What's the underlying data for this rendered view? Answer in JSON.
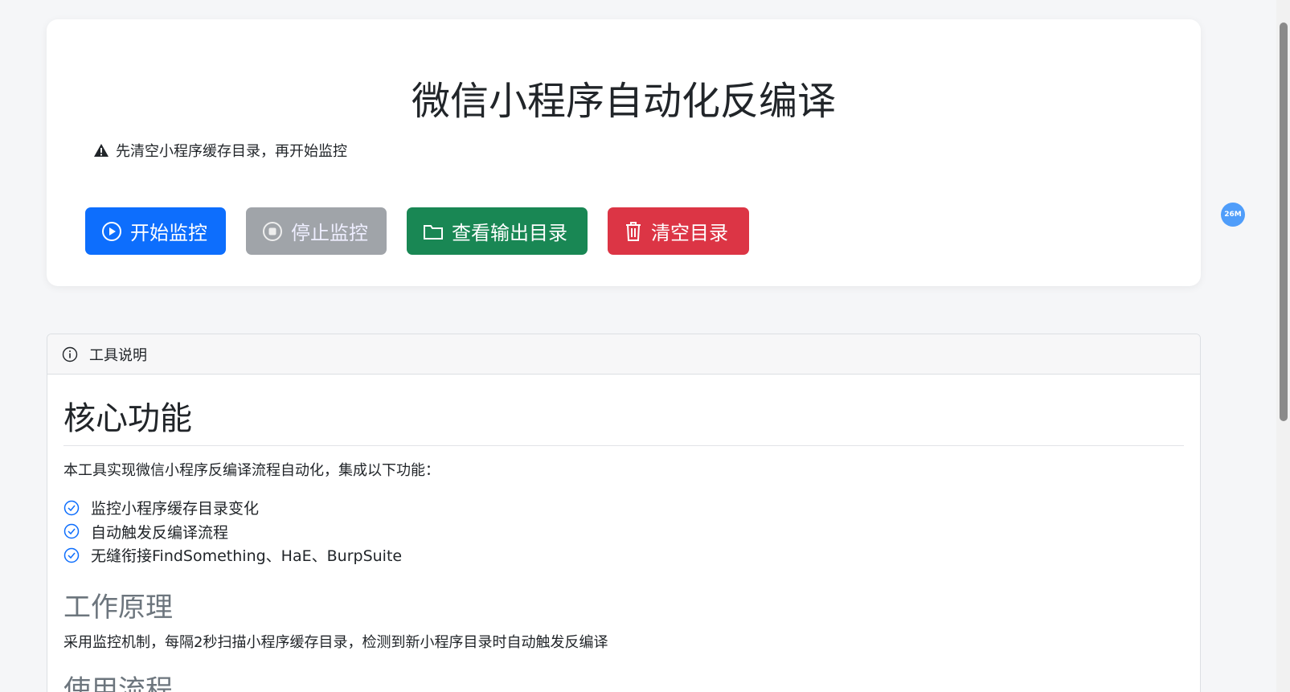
{
  "title": "微信小程序自动化反编译",
  "warning": "先清空小程序缓存目录，再开始监控",
  "buttons": {
    "start": "开始监控",
    "stop": "停止监控",
    "view": "查看输出目录",
    "clear": "清空目录"
  },
  "info": {
    "header": "工具说明",
    "h_core": "核心功能",
    "intro": "本工具实现微信小程序反编译流程自动化，集成以下功能：",
    "features": [
      "监控小程序缓存目录变化",
      "自动触发反编译流程",
      "无缝衔接FindSomething、HaE、BurpSuite"
    ],
    "h_principle": "工作原理",
    "principle": "采用监控机制，每隔2秒扫描小程序缓存目录，检测到新小程序目录时自动触发反编译",
    "h_usage": "使用流程"
  },
  "badge": "26M"
}
